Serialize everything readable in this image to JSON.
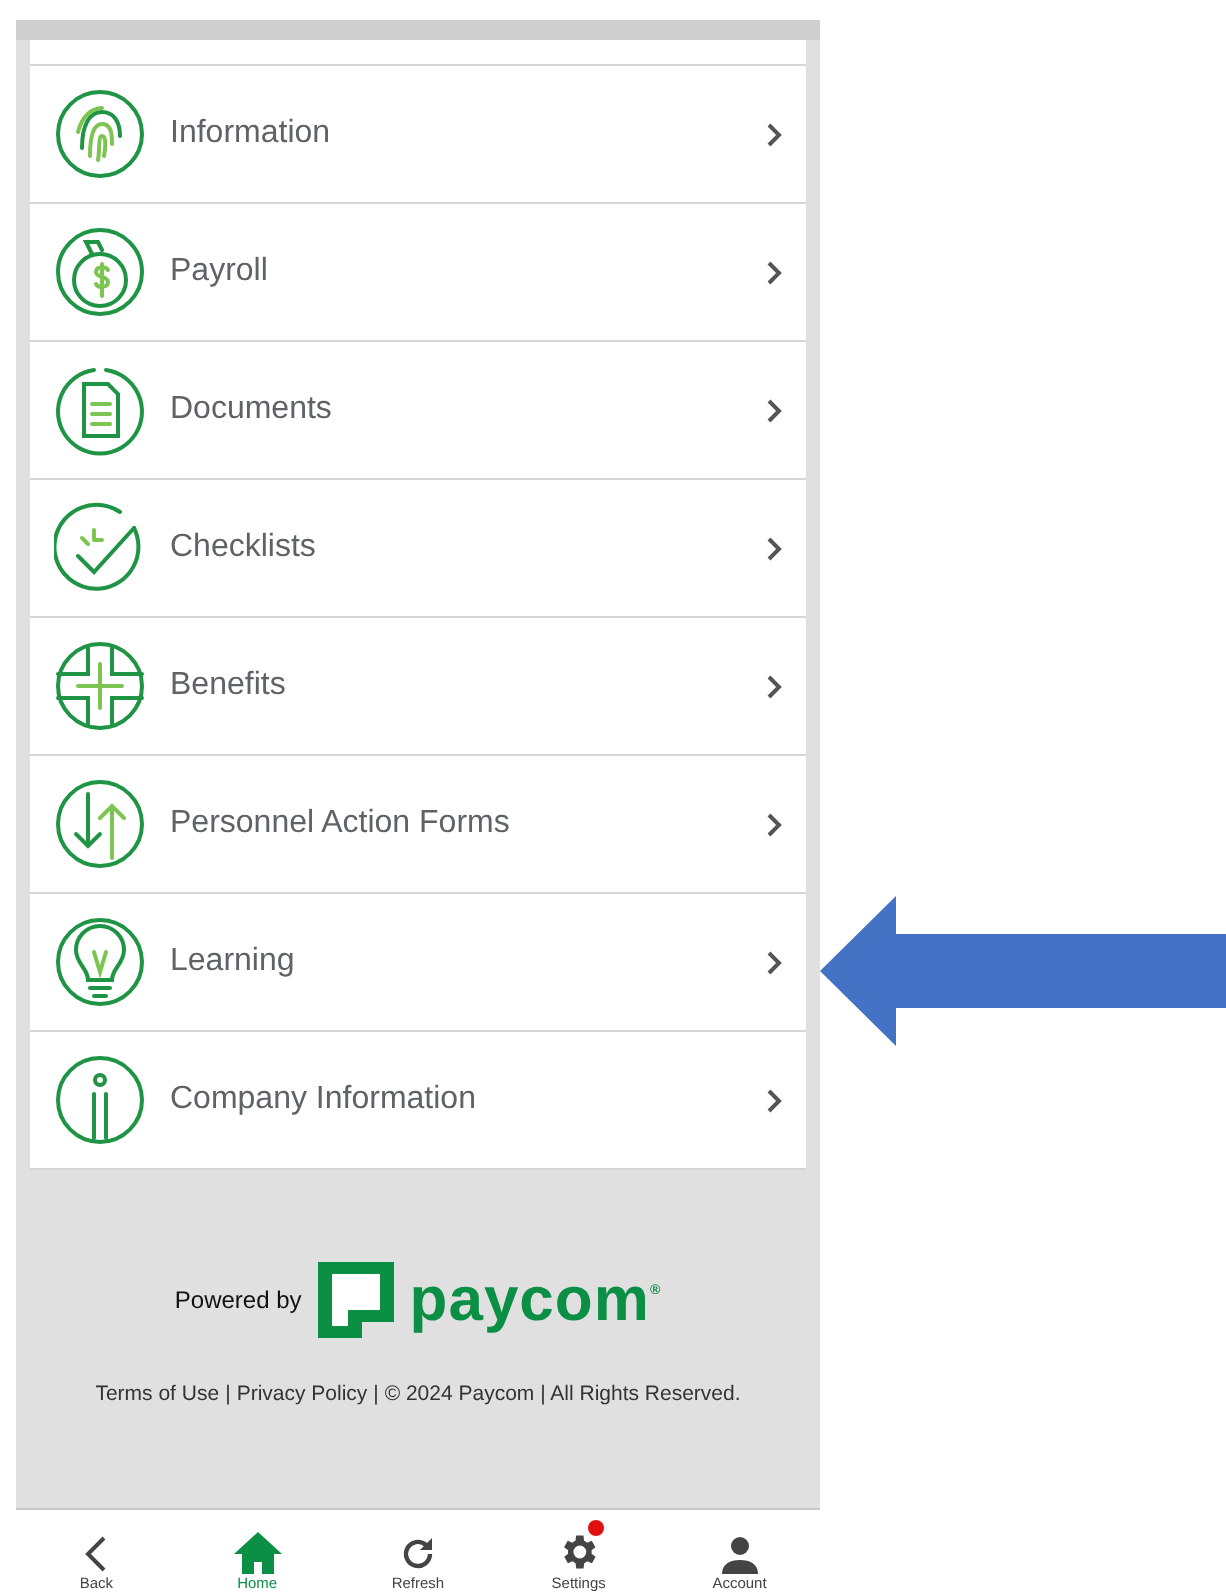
{
  "menu": [
    {
      "label": "Information"
    },
    {
      "label": "Payroll"
    },
    {
      "label": "Documents"
    },
    {
      "label": "Checklists"
    },
    {
      "label": "Benefits"
    },
    {
      "label": "Personnel Action Forms"
    },
    {
      "label": "Learning"
    },
    {
      "label": "Company Information"
    }
  ],
  "footer": {
    "powered_by": "Powered by",
    "logo_text": "paycom",
    "logo_mark": "®",
    "links": [
      "Terms of Use",
      "Privacy Policy"
    ],
    "separator": "|",
    "notice": "| © 2024 Paycom | All Rights Reserved."
  },
  "nav": [
    {
      "label": "Back",
      "selected": false,
      "badge": false
    },
    {
      "label": "Home",
      "selected": true,
      "badge": false
    },
    {
      "label": "Refresh",
      "selected": false,
      "badge": false
    },
    {
      "label": "Settings",
      "selected": false,
      "badge": true
    },
    {
      "label": "Account",
      "selected": false,
      "badge": false
    }
  ]
}
